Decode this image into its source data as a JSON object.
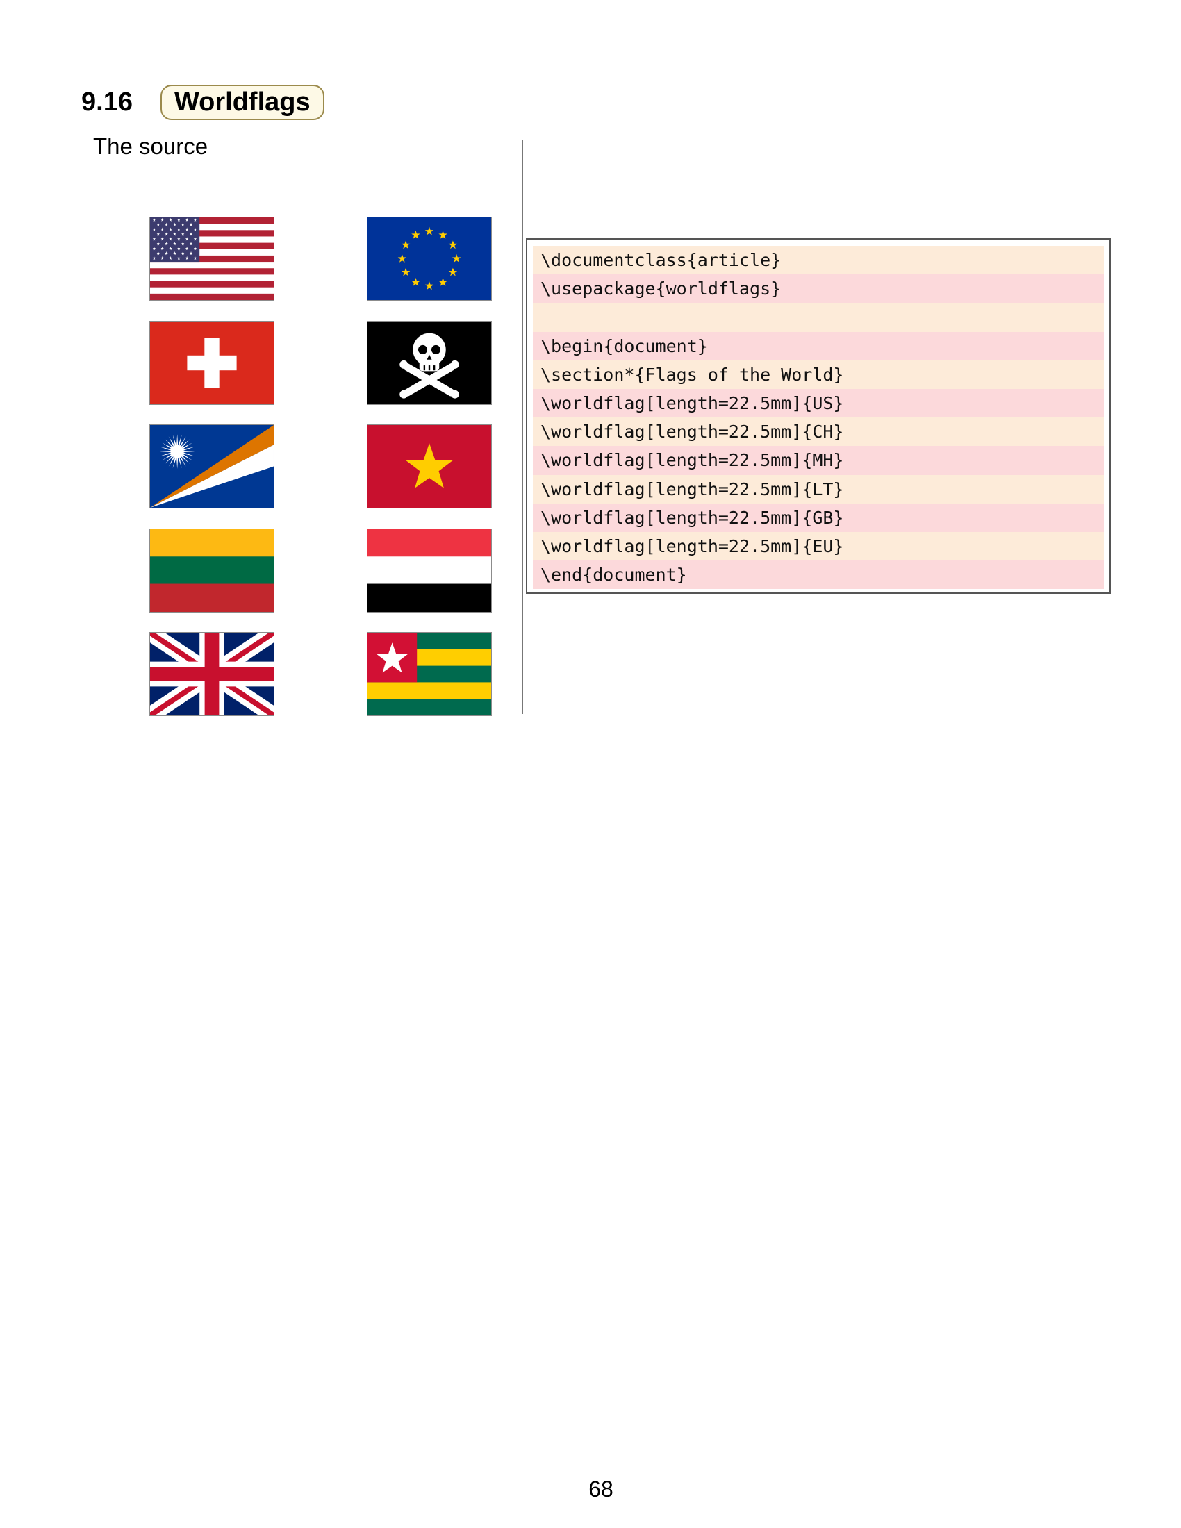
{
  "section": {
    "number": "9.16",
    "title": "Worldflags"
  },
  "source_label": "The source",
  "flags": [
    {
      "code": "US",
      "name": "us-flag"
    },
    {
      "code": "EU",
      "name": "eu-flag"
    },
    {
      "code": "CH",
      "name": "ch-flag"
    },
    {
      "code": "Jolly Roger",
      "name": "pirate-flag"
    },
    {
      "code": "MH",
      "name": "mh-flag"
    },
    {
      "code": "VN",
      "name": "vn-flag"
    },
    {
      "code": "LT",
      "name": "lt-flag"
    },
    {
      "code": "YE",
      "name": "ye-flag"
    },
    {
      "code": "GB",
      "name": "gb-flag"
    },
    {
      "code": "TG",
      "name": "tg-flag"
    }
  ],
  "code": {
    "lines": [
      "\\documentclass{article}",
      "\\usepackage{worldflags}",
      "",
      "\\begin{document}",
      "\\section*{Flags of the World}",
      "\\worldflag[length=22.5mm]{US}",
      "\\worldflag[length=22.5mm]{CH}",
      "\\worldflag[length=22.5mm]{MH}",
      "\\worldflag[length=22.5mm]{LT}",
      "\\worldflag[length=22.5mm]{GB}",
      "\\worldflag[length=22.5mm]{EU}",
      "\\end{document}"
    ]
  },
  "colors": {
    "code_odd_row": "#fdebd9",
    "code_even_row": "#fcd9db",
    "title_box_fill": "#fdf9e6",
    "title_box_border": "#9b8a4c"
  },
  "page_number": "68"
}
